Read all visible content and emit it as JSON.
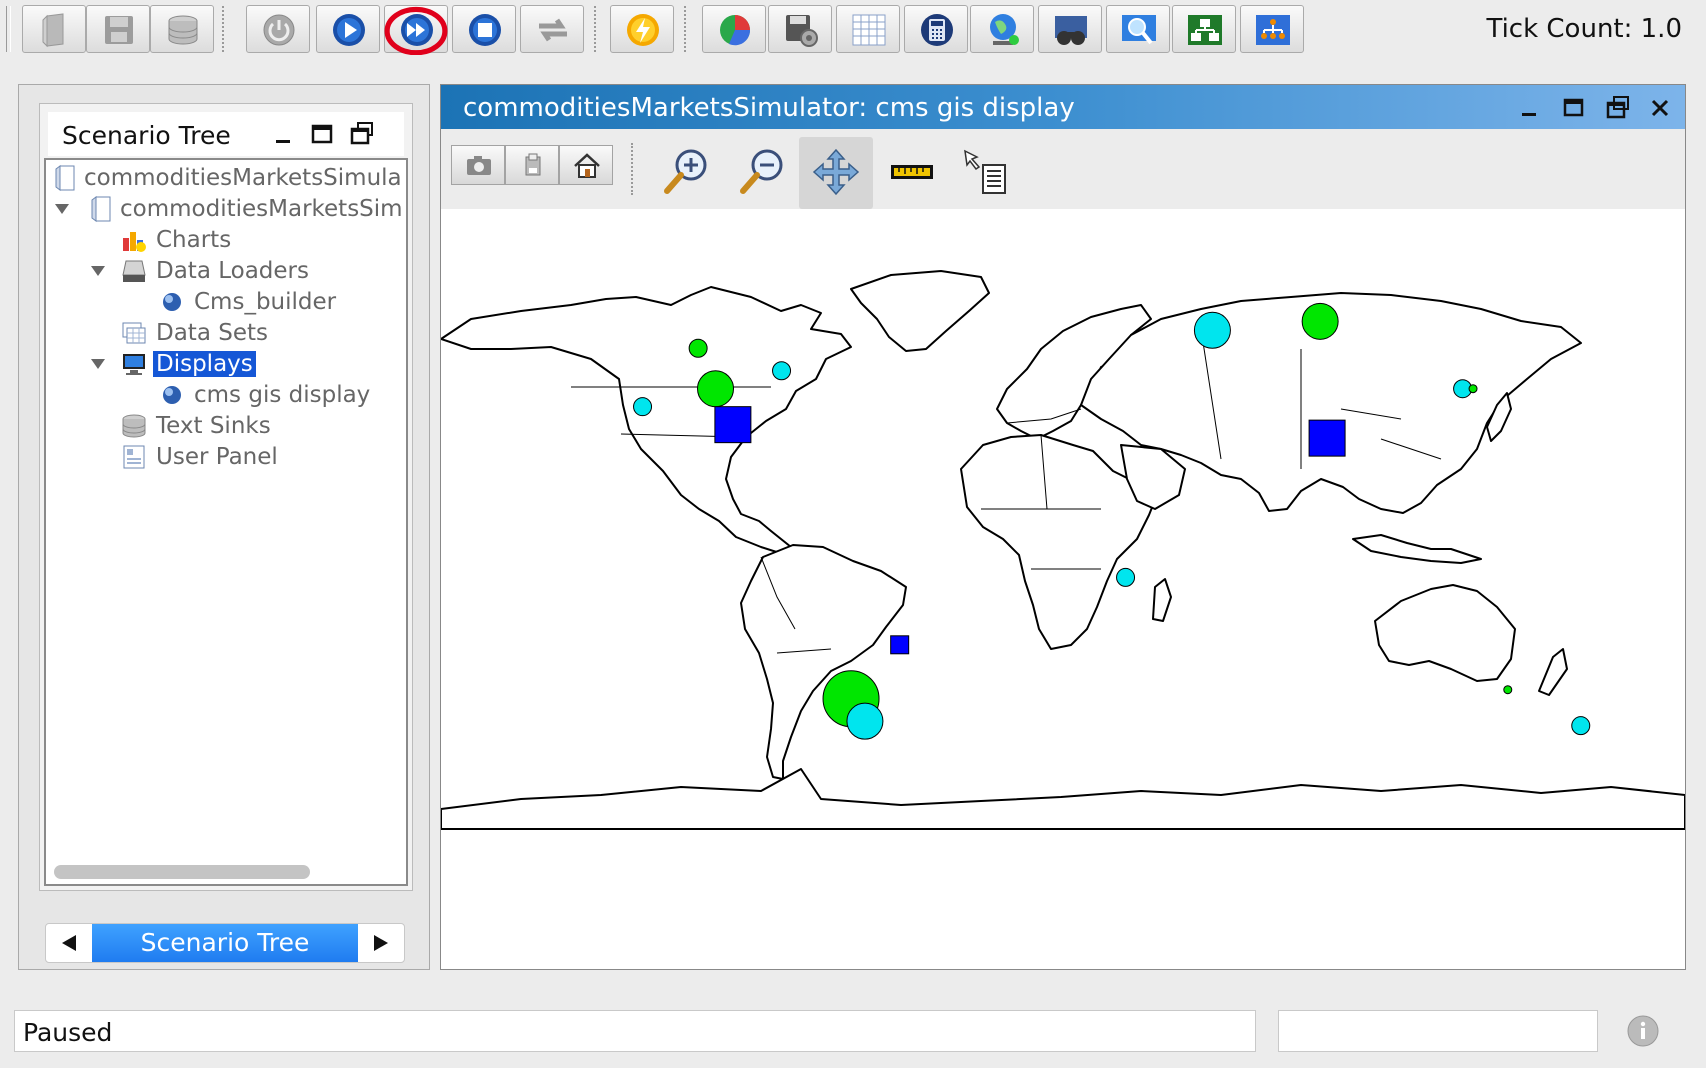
{
  "toolbar": {
    "tick_count": "Tick Count: 1.0",
    "buttons": [
      {
        "name": "new-scenario-icon"
      },
      {
        "name": "save-icon"
      },
      {
        "name": "database-icon"
      },
      {
        "name": "power-icon"
      },
      {
        "name": "start-run-icon"
      },
      {
        "name": "step-run-icon",
        "highlighted": true
      },
      {
        "name": "stop-run-icon"
      },
      {
        "name": "reset-run-icon"
      },
      {
        "name": "flash-icon"
      },
      {
        "name": "chart-icon"
      },
      {
        "name": "disk-settings-icon"
      },
      {
        "name": "spreadsheet-icon"
      },
      {
        "name": "calculator-icon"
      },
      {
        "name": "globe-icon"
      },
      {
        "name": "binoculars-icon"
      },
      {
        "name": "magnifier-icon"
      },
      {
        "name": "network-icon"
      },
      {
        "name": "org-chart-icon"
      }
    ]
  },
  "scenario_panel": {
    "title": "Scenario Tree",
    "tab_label": "Scenario Tree",
    "items": [
      {
        "label": "commoditiesMarketsSimula",
        "icon": "document-icon",
        "expandable": false
      },
      {
        "label": "commoditiesMarketsSim",
        "icon": "document-icon",
        "expandable": true
      },
      {
        "label": "Charts",
        "icon": "charts-icon",
        "expandable": false
      },
      {
        "label": "Data Loaders",
        "icon": "drive-icon",
        "expandable": true
      },
      {
        "label": "Cms_builder",
        "icon": "sphere-icon",
        "expandable": false
      },
      {
        "label": "Data Sets",
        "icon": "dataset-icon",
        "expandable": false
      },
      {
        "label": "Displays",
        "icon": "monitor-icon",
        "expandable": true,
        "selected": true
      },
      {
        "label": "cms gis display",
        "icon": "sphere-icon",
        "expandable": false
      },
      {
        "label": "Text Sinks",
        "icon": "stack-icon",
        "expandable": false
      },
      {
        "label": "User Panel",
        "icon": "panel-icon",
        "expandable": false
      }
    ]
  },
  "display": {
    "title": "commoditiesMarketsSimulator: cms gis display",
    "tools": [
      {
        "name": "camera-icon"
      },
      {
        "name": "export-icon"
      },
      {
        "name": "home-icon"
      },
      {
        "name": "zoom-in-icon"
      },
      {
        "name": "zoom-out-icon"
      },
      {
        "name": "pan-icon",
        "active": true
      },
      {
        "name": "measure-icon"
      },
      {
        "name": "info-tool-icon"
      }
    ],
    "map_markers": [
      {
        "shape": "circle",
        "size": "small",
        "color": "#00e600",
        "lon": -104,
        "lat": 49
      },
      {
        "shape": "circle",
        "size": "large",
        "color": "#00e600",
        "lon": -99,
        "lat": 40
      },
      {
        "shape": "square",
        "size": "large",
        "color": "#0000ff",
        "lon": -94,
        "lat": 32
      },
      {
        "shape": "circle",
        "size": "small",
        "color": "#00e5ee",
        "lon": -120,
        "lat": 36
      },
      {
        "shape": "circle",
        "size": "small",
        "color": "#00e5ee",
        "lon": -80,
        "lat": 44
      },
      {
        "shape": "circle",
        "size": "large",
        "color": "#00e5ee",
        "lon": 44,
        "lat": 53
      },
      {
        "shape": "circle",
        "size": "large",
        "color": "#00e600",
        "lon": 75,
        "lat": 55
      },
      {
        "shape": "circle",
        "size": "small",
        "color": "#00e5ee",
        "lon": 116,
        "lat": 40
      },
      {
        "shape": "circle",
        "size": "tiny",
        "color": "#00e600",
        "lon": 119,
        "lat": 40
      },
      {
        "shape": "square",
        "size": "large",
        "color": "#0000ff",
        "lon": 77,
        "lat": 29
      },
      {
        "shape": "circle",
        "size": "small",
        "color": "#00e5ee",
        "lon": 19,
        "lat": -2
      },
      {
        "shape": "square",
        "size": "small",
        "color": "#0000ff",
        "lon": -46,
        "lat": -17
      },
      {
        "shape": "circle",
        "size": "huge",
        "color": "#00e600",
        "lon": -60,
        "lat": -29
      },
      {
        "shape": "circle",
        "size": "large",
        "color": "#00e5ee",
        "lon": -56,
        "lat": -34
      },
      {
        "shape": "circle",
        "size": "tiny",
        "color": "#00e600",
        "lon": 129,
        "lat": -27
      },
      {
        "shape": "circle",
        "size": "small",
        "color": "#00e5ee",
        "lon": 150,
        "lat": -35
      }
    ]
  },
  "status": {
    "text": "Paused"
  },
  "colors": {
    "selection": "#1557d6",
    "titlebar": "#1c73b5",
    "tab_active": "#1f7cf0",
    "highlight_ring": "#e0001b"
  }
}
